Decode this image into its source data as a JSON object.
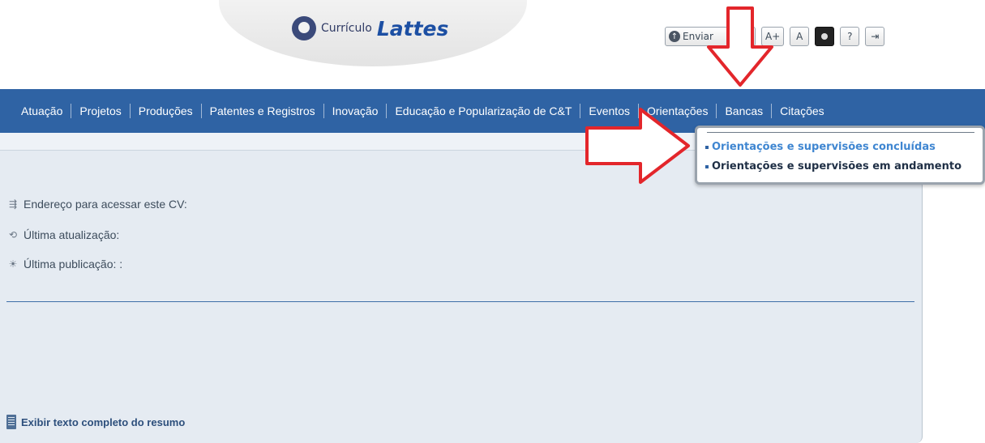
{
  "header": {
    "logo_prefix": "Currículo",
    "logo_name": "Lattes",
    "toolbar": {
      "send_label": "Enviar",
      "font_increase": "A+",
      "font_normal": "A",
      "help": "?"
    }
  },
  "nav": {
    "items": [
      "Atuação",
      "Projetos",
      "Produções",
      "Patentes e Registros",
      "Inovação",
      "Educação e Popularização de C&T",
      "Eventos",
      "Orientações",
      "Bancas",
      "Citações"
    ]
  },
  "content": {
    "address_label": "Endereço para acessar este CV:",
    "last_update_label": "Última atualização:",
    "last_publication_label": "Última publicação: :",
    "resume_link": "Exibir texto completo do resumo"
  },
  "dropdown": {
    "items": [
      "Orientações e supervisões concluídas",
      "Orientações e supervisões em andamento"
    ]
  },
  "colors": {
    "nav_bg": "#2f63a4",
    "panel_bg": "#e5ebf2",
    "arrow": "#e3262b",
    "dropdown_active": "#3f86d1"
  }
}
